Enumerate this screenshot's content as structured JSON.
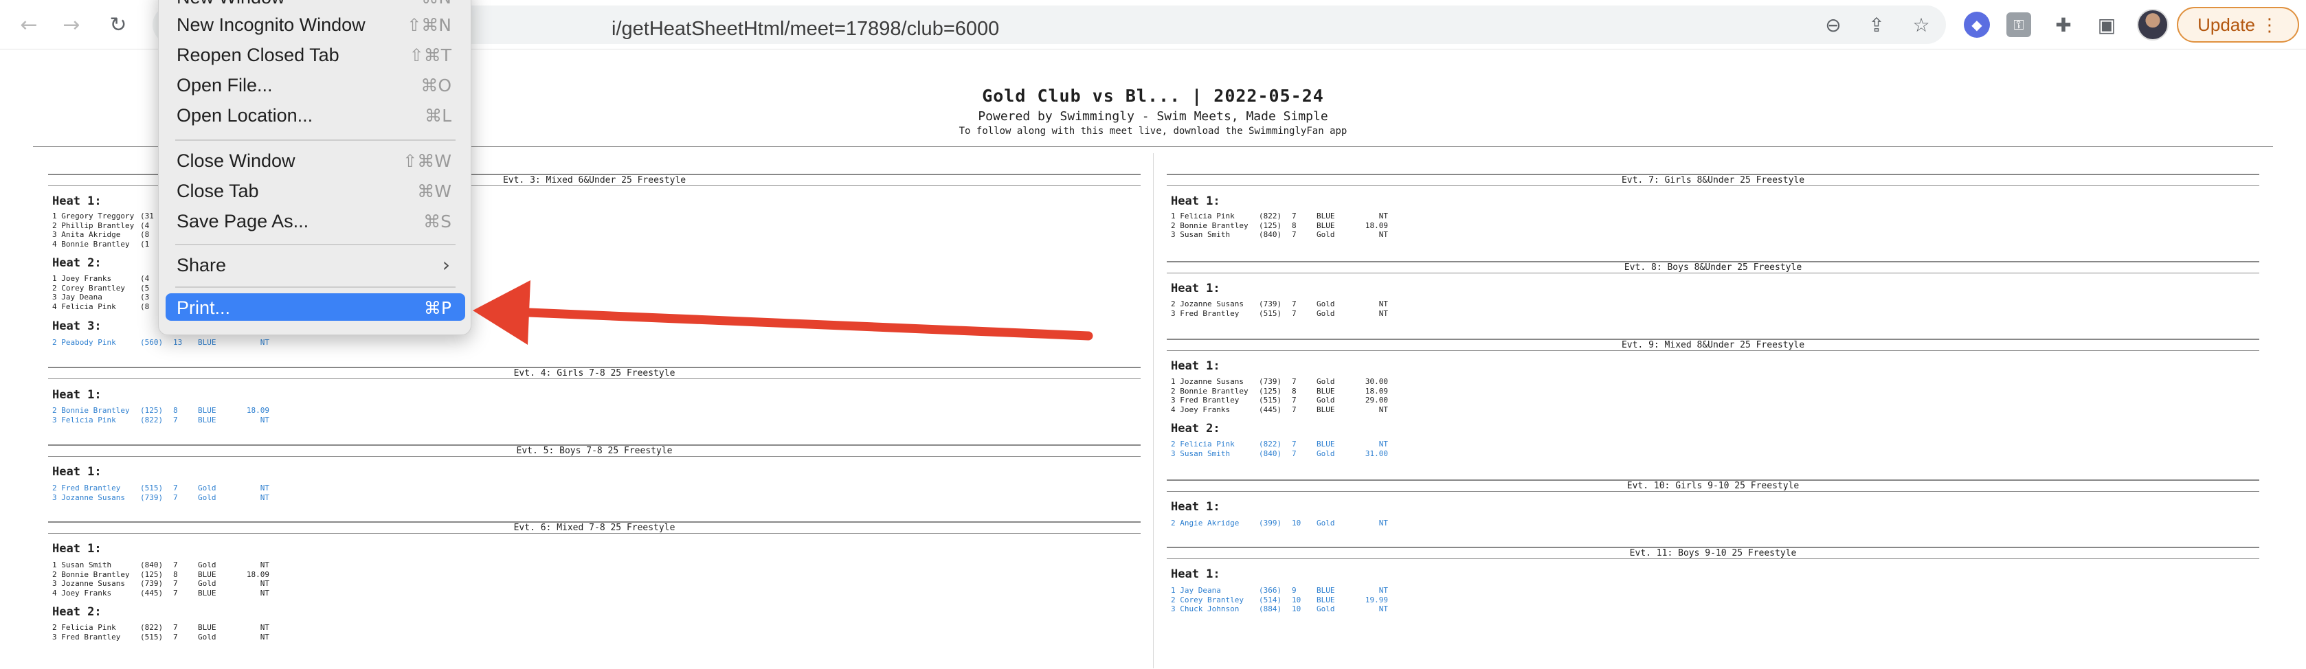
{
  "browser": {
    "url": "i/getHeatSheetHtml/meet=17898/club=6000",
    "update_label": "Update",
    "update_more": "⋮"
  },
  "menu": {
    "items": [
      {
        "label": "New Window",
        "shortcut": "⌘N"
      },
      {
        "label": "New Incognito Window",
        "shortcut": "⇧⌘N"
      },
      {
        "label": "Reopen Closed Tab",
        "shortcut": "⇧⌘T"
      },
      {
        "label": "Open File...",
        "shortcut": "⌘O"
      },
      {
        "label": "Open Location...",
        "shortcut": "⌘L"
      },
      {
        "label": "Close Window",
        "shortcut": "⇧⌘W"
      },
      {
        "label": "Close Tab",
        "shortcut": "⌘W"
      },
      {
        "label": "Save Page As...",
        "shortcut": "⌘S"
      },
      {
        "label": "Share",
        "shortcut": ""
      },
      {
        "label": "Print...",
        "shortcut": "⌘P"
      }
    ],
    "share_chevron": "›"
  },
  "meet": {
    "title": "Gold Club vs Bl... | 2022-05-24",
    "subtitle": "Powered by Swimmingly - Swim Meets, Made Simple",
    "subtitle2": "To follow along with this meet live, download the SwimminglyFan app"
  },
  "events": {
    "e3": {
      "title": "Evt. 3: Mixed 6&Under 25 Freestyle",
      "heat1": {
        "label": "Heat 1:",
        "entries": [
          {
            "name": "1 Gregory Treggory",
            "id": "(31",
            "age": "",
            "team": "",
            "time": "",
            "color": "black"
          },
          {
            "name": "2 Phillip Brantley",
            "id": "(4",
            "age": "",
            "team": "",
            "time": "",
            "color": "black"
          },
          {
            "name": "3 Anita Akridge",
            "id": "(8",
            "age": "",
            "team": "",
            "time": "",
            "color": "black"
          },
          {
            "name": "4 Bonnie Brantley",
            "id": "(1",
            "age": "",
            "team": "",
            "time": "",
            "color": "black"
          }
        ]
      },
      "heat2": {
        "label": "Heat 2:",
        "entries": [
          {
            "name": "1 Joey Franks",
            "id": "(4",
            "age": "",
            "team": "",
            "time": "",
            "color": "black"
          },
          {
            "name": "2 Corey Brantley",
            "id": "(5",
            "age": "",
            "team": "",
            "time": "",
            "color": "black"
          },
          {
            "name": "3 Jay Deana",
            "id": "(3",
            "age": "",
            "team": "",
            "time": "",
            "color": "black"
          },
          {
            "name": "4 Felicia Pink",
            "id": "(8",
            "age": "",
            "team": "",
            "time": "",
            "color": "black"
          }
        ]
      },
      "heat3": {
        "label": "Heat 3:",
        "entries": [
          {
            "name": "2 Peabody Pink",
            "id": "(560)",
            "age": "13",
            "team": "BLUE",
            "time": "NT",
            "color": "blue"
          }
        ]
      }
    },
    "e4": {
      "title": "Evt. 4: Girls 7-8 25 Freestyle",
      "heat1": {
        "label": "Heat 1:",
        "entries": [
          {
            "name": "2 Bonnie Brantley",
            "id": "(125)",
            "age": "8",
            "team": "BLUE",
            "time": "18.09",
            "color": "blue"
          },
          {
            "name": "3 Felicia Pink",
            "id": "(822)",
            "age": "7",
            "team": "BLUE",
            "time": "NT",
            "color": "blue"
          }
        ]
      }
    },
    "e5": {
      "title": "Evt. 5: Boys 7-8 25 Freestyle",
      "heat1": {
        "label": "Heat 1:",
        "entries": [
          {
            "name": "2 Fred Brantley",
            "id": "(515)",
            "age": "7",
            "team": "Gold",
            "time": "NT",
            "color": "blue"
          },
          {
            "name": "3 Jozanne Susans",
            "id": "(739)",
            "age": "7",
            "team": "Gold",
            "time": "NT",
            "color": "blue"
          }
        ]
      }
    },
    "e6": {
      "title": "Evt. 6: Mixed 7-8 25 Freestyle",
      "heat1": {
        "label": "Heat 1:",
        "entries": [
          {
            "name": "1 Susan Smith",
            "id": "(840)",
            "age": "7",
            "team": "Gold",
            "time": "NT",
            "color": "black"
          },
          {
            "name": "2 Bonnie Brantley",
            "id": "(125)",
            "age": "8",
            "team": "BLUE",
            "time": "18.09",
            "color": "black"
          },
          {
            "name": "3 Jozanne Susans",
            "id": "(739)",
            "age": "7",
            "team": "Gold",
            "time": "NT",
            "color": "black"
          },
          {
            "name": "4 Joey Franks",
            "id": "(445)",
            "age": "7",
            "team": "BLUE",
            "time": "NT",
            "color": "black"
          }
        ]
      },
      "heat2": {
        "label": "Heat 2:",
        "entries": [
          {
            "name": "2 Felicia Pink",
            "id": "(822)",
            "age": "7",
            "team": "BLUE",
            "time": "NT",
            "color": "black"
          },
          {
            "name": "3 Fred Brantley",
            "id": "(515)",
            "age": "7",
            "team": "Gold",
            "time": "NT",
            "color": "black"
          }
        ]
      }
    },
    "e7": {
      "title": "Evt. 7: Girls 8&Under 25 Freestyle",
      "heat1": {
        "label": "Heat 1:",
        "entries": [
          {
            "name": "1 Felicia Pink",
            "id": "(822)",
            "age": "7",
            "team": "BLUE",
            "time": "NT",
            "color": "black"
          },
          {
            "name": "2 Bonnie Brantley",
            "id": "(125)",
            "age": "8",
            "team": "BLUE",
            "time": "18.09",
            "color": "black"
          },
          {
            "name": "3 Susan Smith",
            "id": "(840)",
            "age": "7",
            "team": "Gold",
            "time": "NT",
            "color": "black"
          }
        ]
      }
    },
    "e8": {
      "title": "Evt. 8: Boys 8&Under 25 Freestyle",
      "heat1": {
        "label": "Heat 1:",
        "entries": [
          {
            "name": "2 Jozanne Susans",
            "id": "(739)",
            "age": "7",
            "team": "Gold",
            "time": "NT",
            "color": "black"
          },
          {
            "name": "3 Fred Brantley",
            "id": "(515)",
            "age": "7",
            "team": "Gold",
            "time": "NT",
            "color": "black"
          }
        ]
      }
    },
    "e9": {
      "title": "Evt. 9: Mixed 8&Under 25 Freestyle",
      "heat1": {
        "label": "Heat 1:",
        "entries": [
          {
            "name": "1 Jozanne Susans",
            "id": "(739)",
            "age": "7",
            "team": "Gold",
            "time": "30.00",
            "color": "black"
          },
          {
            "name": "2 Bonnie Brantley",
            "id": "(125)",
            "age": "8",
            "team": "BLUE",
            "time": "18.09",
            "color": "black"
          },
          {
            "name": "3 Fred Brantley",
            "id": "(515)",
            "age": "7",
            "team": "Gold",
            "time": "29.00",
            "color": "black"
          },
          {
            "name": "4 Joey Franks",
            "id": "(445)",
            "age": "7",
            "team": "BLUE",
            "time": "NT",
            "color": "black"
          }
        ]
      },
      "heat2": {
        "label": "Heat 2:",
        "entries": [
          {
            "name": "2 Felicia Pink",
            "id": "(822)",
            "age": "7",
            "team": "BLUE",
            "time": "NT",
            "color": "blue"
          },
          {
            "name": "3 Susan Smith",
            "id": "(840)",
            "age": "7",
            "team": "Gold",
            "time": "31.00",
            "color": "blue"
          }
        ]
      }
    },
    "e10": {
      "title": "Evt. 10: Girls 9-10 25 Freestyle",
      "heat1": {
        "label": "Heat 1:",
        "entries": [
          {
            "name": "2 Angie Akridge",
            "id": "(399)",
            "age": "10",
            "team": "Gold",
            "time": "NT",
            "color": "blue"
          }
        ]
      }
    },
    "e11": {
      "title": "Evt. 11: Boys 9-10 25 Freestyle",
      "heat1": {
        "label": "Heat 1:",
        "entries": [
          {
            "name": "1 Jay Deana",
            "id": "(366)",
            "age": "9",
            "team": "BLUE",
            "time": "NT",
            "color": "blue"
          },
          {
            "name": "2 Corey Brantley",
            "id": "(514)",
            "age": "10",
            "team": "BLUE",
            "time": "19.99",
            "color": "blue"
          },
          {
            "name": "3 Chuck Johnson",
            "id": "(884)",
            "age": "10",
            "team": "Gold",
            "time": "NT",
            "color": "blue"
          }
        ]
      }
    }
  },
  "colors": {
    "menu_highlight": "#3b82f6",
    "annotation_arrow": "#e5412d",
    "entry_blue": "#2d7fd0",
    "update_accent": "#e0913f"
  }
}
